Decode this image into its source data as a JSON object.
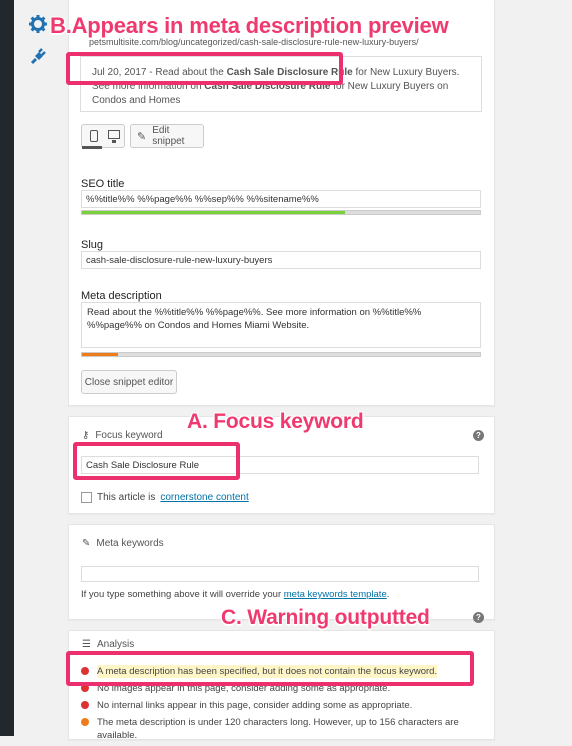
{
  "annotations": {
    "b": "B.Appears in meta description preview",
    "a": "A. Focus keyword",
    "c": "C. Warning outputted"
  },
  "snippet_preview": {
    "url": "petsmultisite.com/blog/uncategorized/cash-sale-disclosure-rule-new-luxury-buyers/",
    "date": "Jul 20, 2017",
    "desc_prefix": " - Read about the ",
    "desc_bold": "Cash Sale Disclosure Rule",
    "desc_mid": " for New Luxury Buyers. See more information on ",
    "desc_bold2": "Cash Sale Disclosure Rule",
    "desc_suffix": " for New Luxury Buyers on Condos and Homes"
  },
  "toolbar": {
    "edit_snippet": "Edit snippet",
    "close_snippet_editor": "Close snippet editor"
  },
  "seo_title": {
    "label": "SEO title",
    "value": "%%title%% %%page%% %%sep%% %%sitename%%",
    "progress": 0.66,
    "color": "#7ad03a"
  },
  "slug": {
    "label": "Slug",
    "value": "cash-sale-disclosure-rule-new-luxury-buyers"
  },
  "meta_description": {
    "label": "Meta description",
    "value": "Read about the %%title%% %%page%%. See more information on %%title%% %%page%% on Condos and Homes Miami Website.",
    "progress": 0.09,
    "color": "#ee7c1b"
  },
  "focus_keyword": {
    "label": "Focus keyword",
    "value": "Cash Sale Disclosure Rule",
    "cornerstone_prefix": "This article is ",
    "cornerstone_link": "cornerstone content"
  },
  "meta_keywords": {
    "label": "Meta keywords",
    "value": "",
    "hint_prefix": "If you type something above it will override your ",
    "hint_link": "meta keywords template",
    "hint_suffix": "."
  },
  "analysis": {
    "label": "Analysis",
    "items": [
      {
        "text": "A meta description has been specified, but it does not contain the focus keyword.",
        "status": "bad",
        "color": "#dc3232"
      },
      {
        "text": "No images appear in this page, consider adding some as appropriate.",
        "status": "bad",
        "color": "#dc3232"
      },
      {
        "text": "No internal links appear in this page, consider adding some as appropriate.",
        "status": "bad",
        "color": "#dc3232"
      },
      {
        "text": "The meta description is under 120 characters long. However, up to 156 characters are available.",
        "status": "ok",
        "color": "#ee7c1b"
      }
    ]
  },
  "icons": {
    "rail": [
      "gear-icon",
      "plug-icon"
    ],
    "focus": "key-icon",
    "meta": "pencil-icon",
    "analysis": "list-icon",
    "help": "?"
  }
}
